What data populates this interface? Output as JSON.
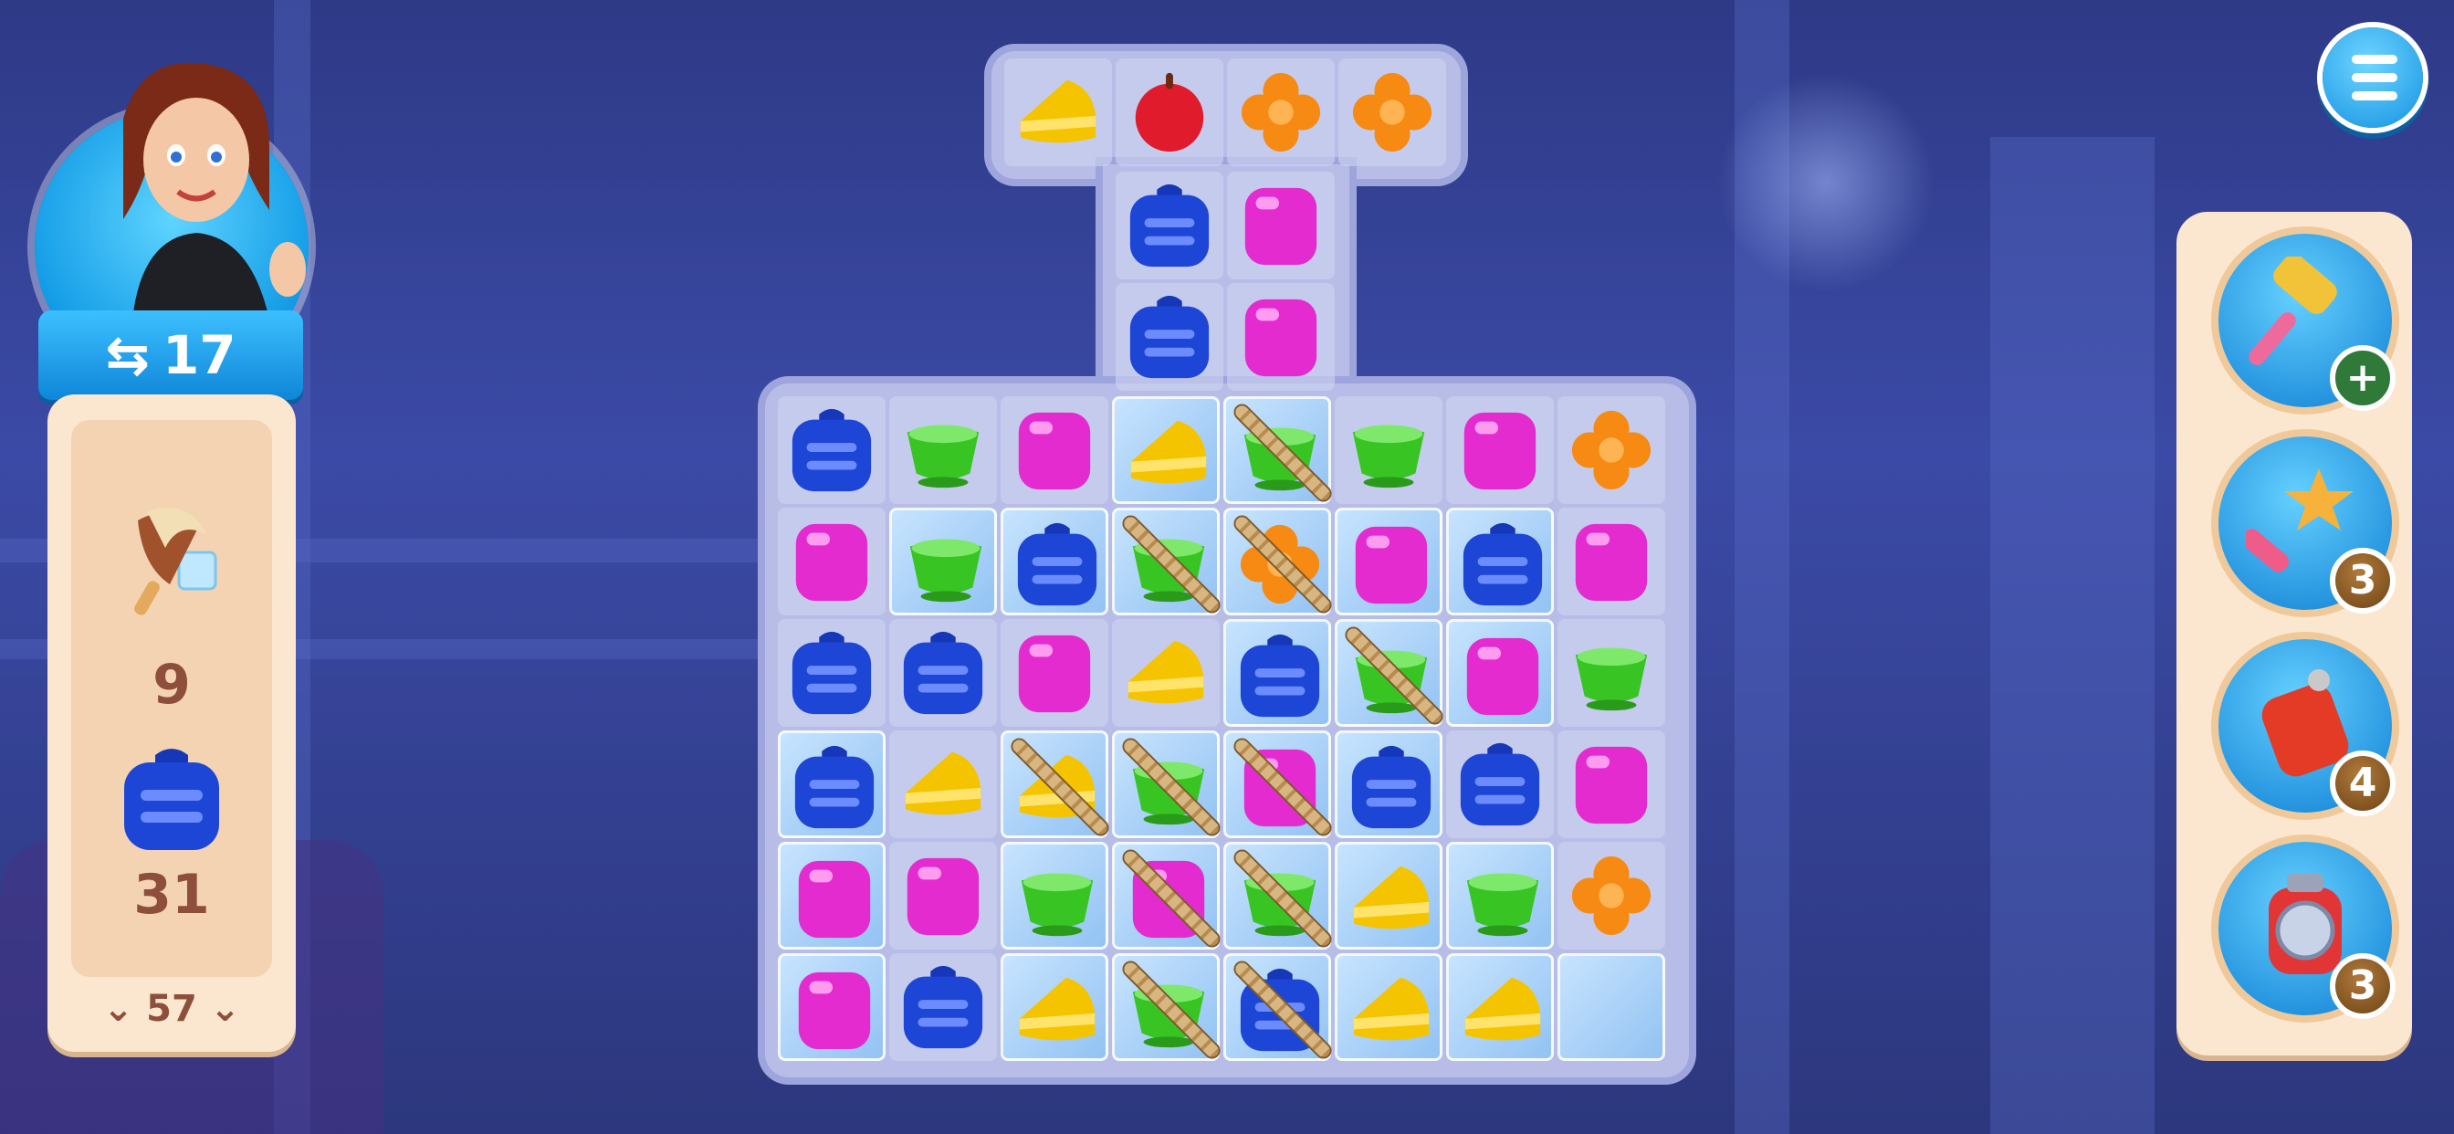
{
  "hud": {
    "moves_left": "17",
    "level": "57"
  },
  "goals": [
    {
      "icon": "ice-cream-icon",
      "count": "9"
    },
    {
      "icon": "blue-backpack-icon",
      "count": "31"
    }
  ],
  "boosters": [
    {
      "icon": "hammer-icon",
      "badge": "+",
      "badge_type": "add"
    },
    {
      "icon": "magic-wand-icon",
      "badge": "3",
      "badge_type": "count"
    },
    {
      "icon": "dynamite-icon",
      "badge": "4",
      "badge_type": "count"
    },
    {
      "icon": "lantern-bomb-icon",
      "badge": "3",
      "badge_type": "count"
    }
  ],
  "board": {
    "piece_colors": {
      "cheese": "#f5c400",
      "apple": "#e01b2b",
      "flower": "#f68a12",
      "bag": "#1d46d6",
      "cube": "#e42bd0",
      "cup": "#38c524"
    },
    "top_row": [
      "cheese",
      "apple",
      "flower",
      "flower"
    ],
    "stem_rows": [
      [
        "bag",
        "cube"
      ],
      [
        "bag",
        "cube"
      ]
    ],
    "main_rows": [
      [
        {
          "p": "bag"
        },
        {
          "p": "cup"
        },
        {
          "p": "cube"
        },
        {
          "p": "cheese",
          "ice": true
        },
        {
          "p": "cup",
          "ice": true,
          "rope": true
        },
        {
          "p": "cup"
        },
        {
          "p": "cube"
        },
        {
          "p": "flower"
        }
      ],
      [
        {
          "p": "cube"
        },
        {
          "p": "cup",
          "ice": true
        },
        {
          "p": "bag",
          "ice": true
        },
        {
          "p": "cup",
          "ice": true,
          "rope": true
        },
        {
          "p": "flower",
          "ice": true,
          "rope": true
        },
        {
          "p": "cube",
          "ice": true
        },
        {
          "p": "bag",
          "ice": true
        },
        {
          "p": "cube"
        }
      ],
      [
        {
          "p": "bag"
        },
        {
          "p": "bag"
        },
        {
          "p": "cube"
        },
        {
          "p": "cheese"
        },
        {
          "p": "bag",
          "ice": true
        },
        {
          "p": "cup",
          "ice": true,
          "rope": true
        },
        {
          "p": "cube",
          "ice": true
        },
        {
          "p": "cup"
        }
      ],
      [
        {
          "p": "bag",
          "ice": true
        },
        {
          "p": "cheese"
        },
        {
          "p": "cheese",
          "ice": true,
          "rope": true
        },
        {
          "p": "cup",
          "ice": true,
          "rope": true
        },
        {
          "p": "cube",
          "ice": true,
          "rope": true
        },
        {
          "p": "bag",
          "ice": true
        },
        {
          "p": "bag"
        },
        {
          "p": "cube"
        }
      ],
      [
        {
          "p": "cube",
          "ice": true
        },
        {
          "p": "cube"
        },
        {
          "p": "cup",
          "ice": true
        },
        {
          "p": "cube",
          "ice": true,
          "rope": true
        },
        {
          "p": "cup",
          "ice": true,
          "rope": true
        },
        {
          "p": "cheese",
          "ice": true
        },
        {
          "p": "cup",
          "ice": true
        },
        {
          "p": "flower"
        }
      ],
      [
        {
          "p": "cube",
          "ice": true
        },
        {
          "p": "bag"
        },
        {
          "p": "cheese",
          "ice": true
        },
        {
          "p": "cup",
          "ice": true,
          "rope": true
        },
        {
          "p": "bag",
          "ice": true,
          "rope": true
        },
        {
          "p": "cheese",
          "ice": true
        },
        {
          "p": "cheese",
          "ice": true
        },
        {
          "p": "empty",
          "ice": true
        }
      ]
    ]
  }
}
